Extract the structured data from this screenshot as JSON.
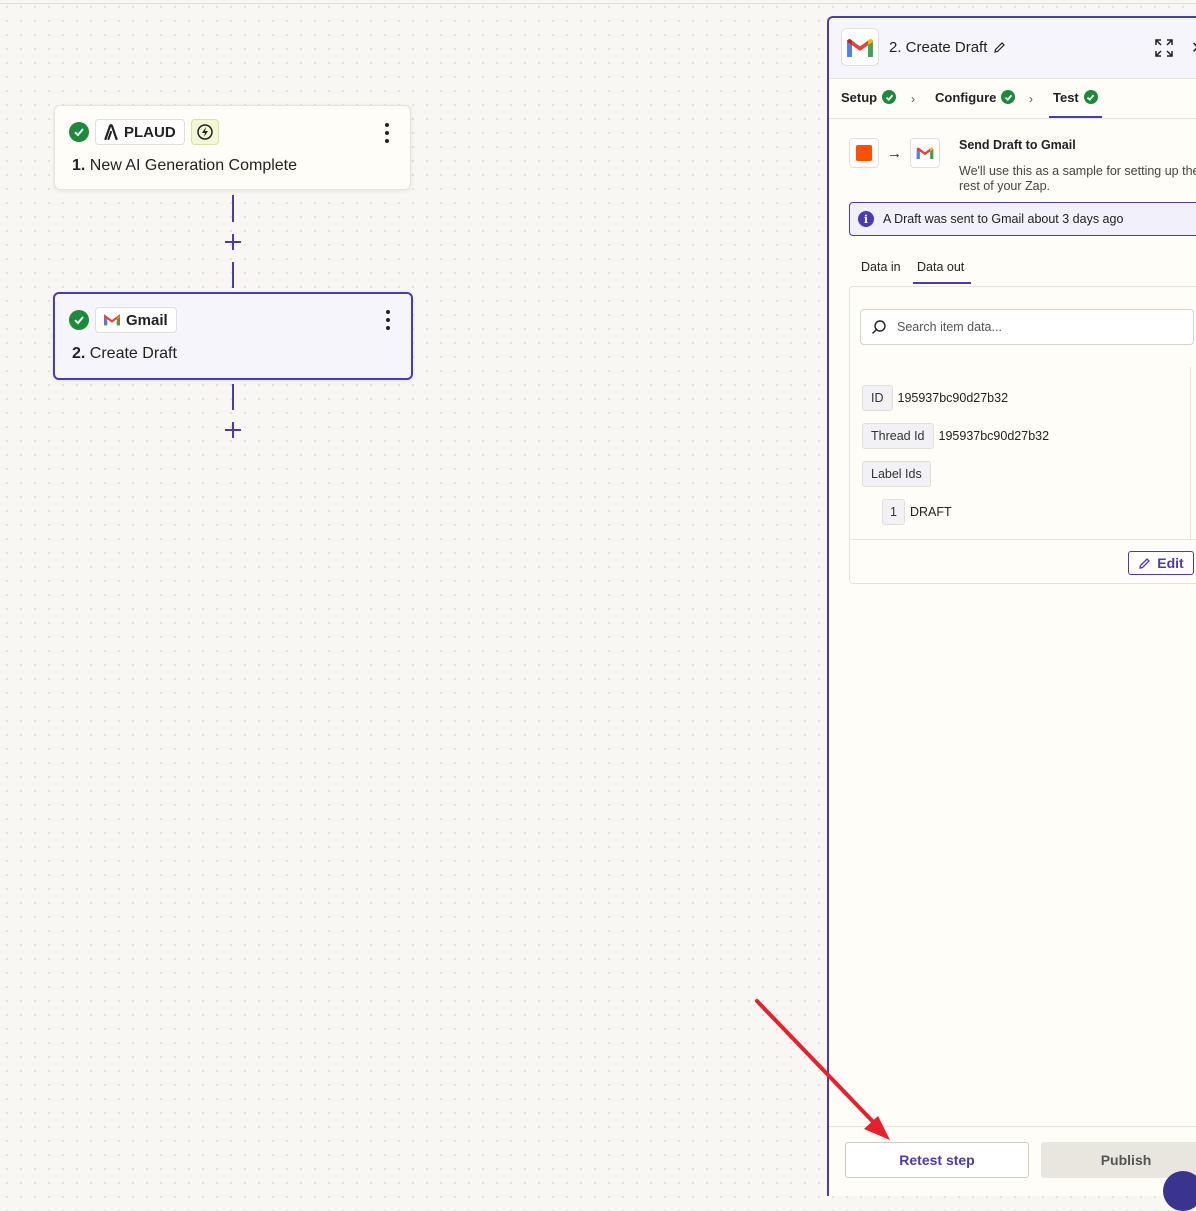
{
  "canvas": {
    "steps": [
      {
        "app_name": "PLAUD",
        "number": "1.",
        "title": "New AI Generation Complete",
        "status": "complete",
        "trigger_icon": "lightning-bolt-icon"
      },
      {
        "app_name": "Gmail",
        "number": "2.",
        "title": "Create Draft",
        "status": "complete",
        "selected": true
      }
    ]
  },
  "panel": {
    "title": "2. Create Draft",
    "tabs": [
      {
        "label": "Setup",
        "status": "complete"
      },
      {
        "label": "Configure",
        "status": "complete"
      },
      {
        "label": "Test",
        "status": "complete",
        "active": true
      }
    ],
    "test": {
      "send_title": "Send Draft to Gmail",
      "send_desc": "We'll use this as a sample for setting up the rest of your Zap.",
      "info_text": "A Draft was sent to Gmail about 3 days ago",
      "data_tabs": [
        "Data in",
        "Data out"
      ],
      "active_data_tab": "Data out",
      "search_placeholder": "Search item data...",
      "fields": {
        "id_label": "ID",
        "id_value": "195937bc90d27b32",
        "thread_label": "Thread Id",
        "thread_value": "195937bc90d27b32",
        "labels_label": "Label Ids",
        "label_index": "1",
        "label_value": "DRAFT"
      },
      "edit_label": "Edit"
    },
    "footer": {
      "retest_label": "Retest step",
      "publish_label": "Publish"
    }
  },
  "colors": {
    "accent": "#4b3ab5",
    "success": "#1c8a3a",
    "zapier_orange": "#ff4f00",
    "annotation_arrow": "#e8202a"
  }
}
